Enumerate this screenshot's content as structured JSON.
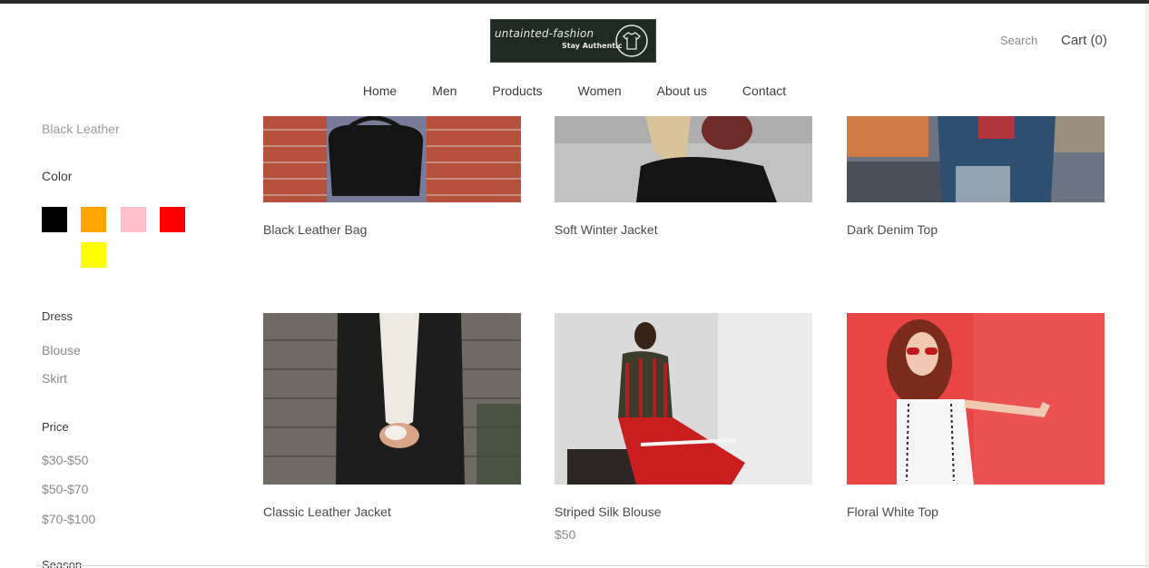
{
  "header": {
    "logo_title": "untainted-fashion",
    "logo_tagline": "Stay Authentic",
    "search_label": "Search",
    "cart_label": "Cart (0)"
  },
  "nav": {
    "items": [
      "Home",
      "Men",
      "Products",
      "Women",
      "About us",
      "Contact"
    ]
  },
  "sidebar": {
    "material_item": "Black Leather",
    "color_heading": "Color",
    "colors": [
      "#000000",
      "#ffa500",
      "#ffc0cb",
      "#ff0000",
      "#ffff00"
    ],
    "dress_heading": "Dress",
    "dress_items": [
      "Blouse",
      "Skirt"
    ],
    "price_heading": "Price",
    "price_items": [
      "$30-$50",
      "$50-$70",
      "$70-$100"
    ],
    "season_heading": "Season"
  },
  "products": [
    {
      "title": "Black Leather Bag",
      "price": "",
      "image": "black-leather-bag-photo"
    },
    {
      "title": "Soft Winter Jacket",
      "price": "",
      "image": "soft-winter-jacket-photo"
    },
    {
      "title": "Dark Denim Top",
      "price": "",
      "image": "dark-denim-top-photo"
    },
    {
      "title": "Classic Leather Jacket",
      "price": "",
      "image": "classic-leather-jacket-photo"
    },
    {
      "title": "Striped Silk Blouse",
      "price": "$50",
      "image": "striped-silk-blouse-photo"
    },
    {
      "title": "Floral White Top",
      "price": "",
      "image": "floral-white-top-photo"
    }
  ]
}
